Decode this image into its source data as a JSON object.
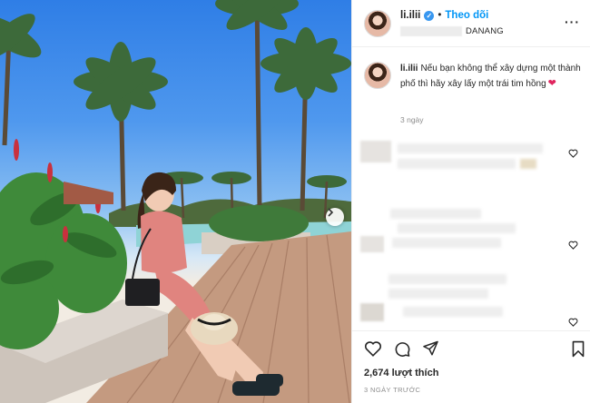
{
  "post": {
    "username": "li.ilii",
    "follow_label": "Theo dõi",
    "location_suffix": "DANANG",
    "caption_username": "li.ilii",
    "caption_text": "Nếu bạn không thể xây dựng một thành phố thì hãy xây lấy một trái tim hồng",
    "caption_emoji": "❤",
    "caption_time": "3 ngày",
    "likes": "2,674 lượt thích",
    "posted": "3 NGÀY TRƯỚC"
  },
  "icons": {
    "more": "more-options-icon",
    "verified": "verified-badge-icon",
    "like": "heart-icon",
    "comment": "comment-icon",
    "share": "send-icon",
    "save": "bookmark-icon",
    "next": "chevron-right-icon"
  },
  "colors": {
    "accent": "#0095f6",
    "verified": "#3897f0",
    "muted_text": "#8e8e8e",
    "divider": "#efefef"
  }
}
